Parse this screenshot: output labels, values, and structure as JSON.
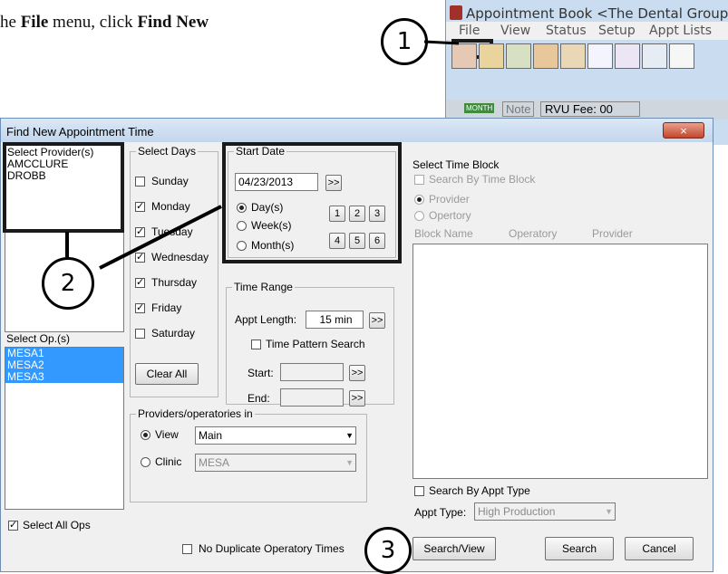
{
  "instruction": {
    "prefix": "he ",
    "menu": "File",
    "middle": " menu, click ",
    "action": "Find New"
  },
  "appt_book": {
    "title": "Appointment Book <The Dental Group",
    "menu": [
      "File",
      "View",
      "Status",
      "Setup",
      "Appt Lists"
    ],
    "row3": {
      "month_badge": "MONTH",
      "note": "Note",
      "rvu": "RVU Fee: 00"
    }
  },
  "callouts": {
    "one": "1",
    "two": "2",
    "three": "3"
  },
  "dialog": {
    "title": "Find New Appointment Time",
    "close_glyph": "×",
    "providers": {
      "label": "Select Provider(s)",
      "items": [
        "AMCCLURE",
        "DROBB"
      ]
    },
    "ops": {
      "label": "Select Op.(s)",
      "items": [
        "MESA1",
        "MESA2",
        "MESA3"
      ],
      "select_all": "Select All Ops"
    },
    "days": {
      "label": "Select Days",
      "items": [
        {
          "name": "Sunday",
          "checked": false
        },
        {
          "name": "Monday",
          "checked": true
        },
        {
          "name": "Tuesday",
          "checked": true
        },
        {
          "name": "Wednesday",
          "checked": true
        },
        {
          "name": "Thursday",
          "checked": true
        },
        {
          "name": "Friday",
          "checked": true
        },
        {
          "name": "Saturday",
          "checked": false
        }
      ],
      "clear_all": "Clear All"
    },
    "start_date": {
      "label": "Start Date",
      "value": "04/23/2013",
      "next": ">>",
      "units": [
        "Day(s)",
        "Week(s)",
        "Month(s)"
      ],
      "numbers": [
        "1",
        "2",
        "3",
        "4",
        "5",
        "6"
      ]
    },
    "time_range": {
      "label": "Time Range",
      "appt_length_label": "Appt Length:",
      "appt_length": "15 min",
      "next": ">>",
      "pattern_search": "Time Pattern Search",
      "start_label": "Start:",
      "end_label": "End:"
    },
    "prov_ops_in": {
      "label": "Providers/operatories in",
      "view_label": "View",
      "view_value": "Main",
      "clinic_label": "Clinic",
      "clinic_value": "MESA"
    },
    "time_block": {
      "label": "Select Time Block",
      "search_by_block": "Search By Time Block",
      "provider": "Provider",
      "opertory": "Opertory",
      "columns": [
        "Block Name",
        "Operatory",
        "Provider"
      ],
      "search_by_appt_type": "Search By Appt Type",
      "appt_type_label": "Appt Type:",
      "appt_type_value": "High Production"
    },
    "footer": {
      "no_dup": "No Duplicate Operatory Times",
      "search_view": "Search/View",
      "search": "Search",
      "cancel": "Cancel"
    }
  }
}
